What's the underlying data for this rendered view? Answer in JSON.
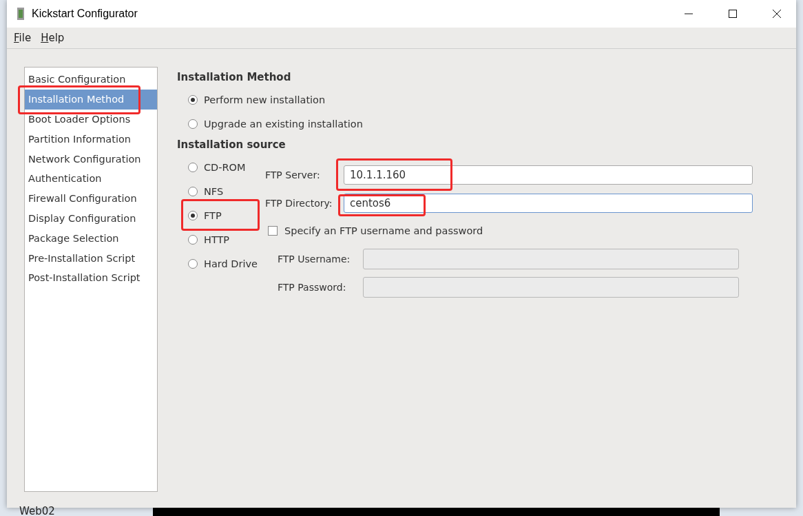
{
  "window": {
    "title": "Kickstart Configurator"
  },
  "menu": [
    {
      "label": "File"
    },
    {
      "label": "Help"
    }
  ],
  "sidebar": {
    "items": [
      {
        "label": "Basic Configuration",
        "selected": false,
        "highlighted": false
      },
      {
        "label": "Installation Method",
        "selected": true,
        "highlighted": true
      },
      {
        "label": "Boot Loader Options",
        "selected": false,
        "highlighted": false
      },
      {
        "label": "Partition Information",
        "selected": false,
        "highlighted": false
      },
      {
        "label": "Network Configuration",
        "selected": false,
        "highlighted": false
      },
      {
        "label": "Authentication",
        "selected": false,
        "highlighted": false
      },
      {
        "label": "Firewall Configuration",
        "selected": false,
        "highlighted": false
      },
      {
        "label": "Display Configuration",
        "selected": false,
        "highlighted": false
      },
      {
        "label": "Package Selection",
        "selected": false,
        "highlighted": false
      },
      {
        "label": "Pre-Installation Script",
        "selected": false,
        "highlighted": false
      },
      {
        "label": "Post-Installation Script",
        "selected": false,
        "highlighted": false
      }
    ]
  },
  "installation_method": {
    "title": "Installation Method",
    "options": [
      {
        "label": "Perform new installation",
        "selected": true
      },
      {
        "label": "Upgrade an existing installation",
        "selected": false
      }
    ]
  },
  "installation_source": {
    "title": "Installation source",
    "options": [
      {
        "label": "CD-ROM",
        "selected": false,
        "highlighted": false
      },
      {
        "label": "NFS",
        "selected": false,
        "highlighted": false
      },
      {
        "label": "FTP",
        "selected": true,
        "highlighted": true
      },
      {
        "label": "HTTP",
        "selected": false,
        "highlighted": false
      },
      {
        "label": "Hard Drive",
        "selected": false,
        "highlighted": false
      }
    ],
    "fields": [
      {
        "label": "FTP Server:",
        "value": "10.1.1.160",
        "focused": false,
        "highlighted": true
      },
      {
        "label": "FTP Directory:",
        "value": "centos6",
        "focused": true,
        "highlighted": true
      }
    ],
    "auth": {
      "label": "Specify an FTP username and password",
      "checked": false
    },
    "auth_fields": [
      {
        "label": "FTP Username:",
        "disabled": true
      },
      {
        "label": "FTP Password:",
        "disabled": true
      }
    ]
  },
  "background": {
    "taskbar_item": "Web02"
  }
}
